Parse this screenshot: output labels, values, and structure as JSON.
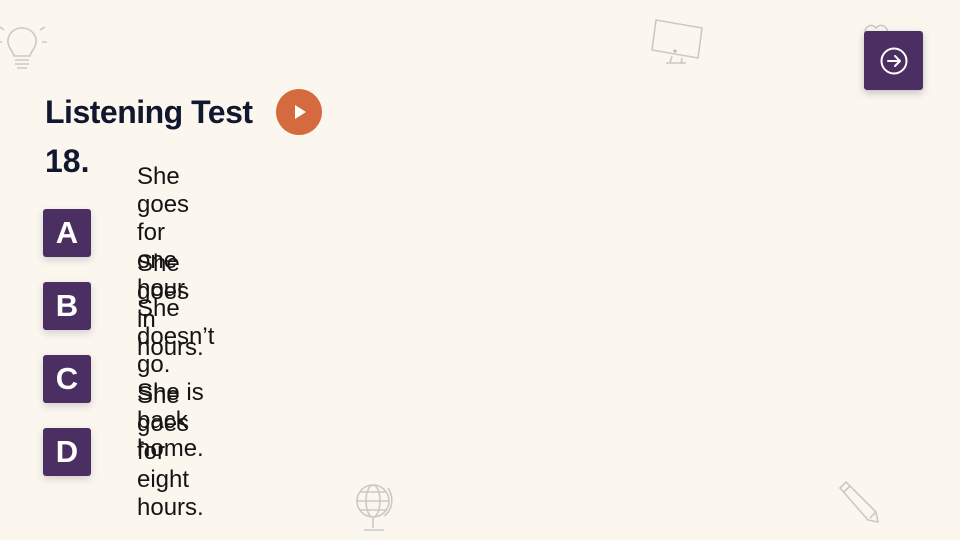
{
  "title": "Listening Test",
  "question_number": "18.",
  "options": [
    {
      "letter": "A",
      "text": "She goes for one hour."
    },
    {
      "letter": "B",
      "text": "She goes in hours."
    },
    {
      "letter": "C",
      "text": "She doesn’t go. She is back home."
    },
    {
      "letter": "D",
      "text": "She goes for eight hours."
    }
  ],
  "icons": {
    "play": "play-icon",
    "next": "arrow-right-circle-icon",
    "decor": [
      "lightbulb-icon",
      "monitor-icon",
      "globe-icon",
      "pencil-icon",
      "heart-icon"
    ]
  },
  "colors": {
    "background": "#fbf7ef",
    "accent_purple": "#4b2e62",
    "play_orange": "#d46a3e",
    "title_text": "#10172f"
  }
}
